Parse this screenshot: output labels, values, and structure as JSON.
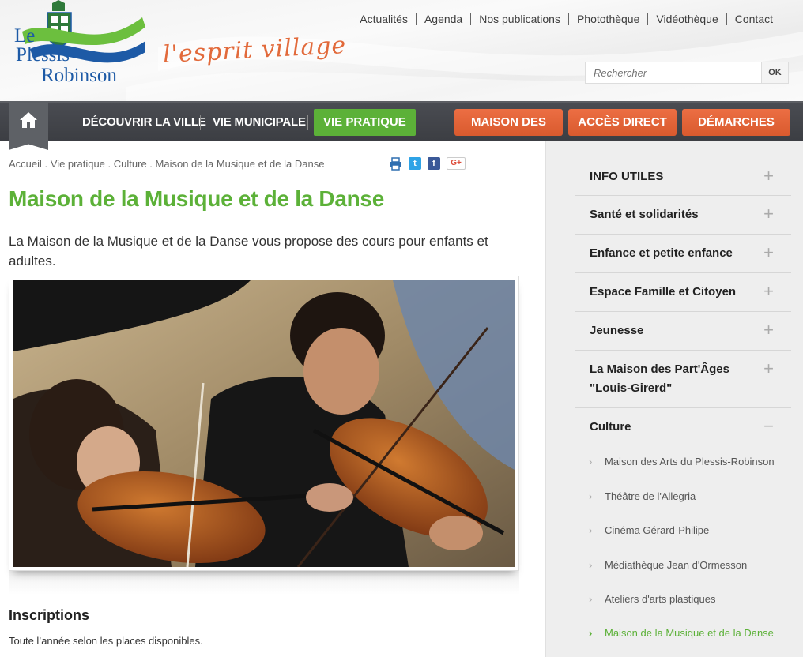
{
  "header": {
    "logo": {
      "line1": "Le",
      "line2": "Plessis",
      "line3": "Robinson"
    },
    "slogan": "l'esprit village",
    "top_links": [
      "Actualités",
      "Agenda",
      "Nos publications",
      "Photothèque",
      "Vidéothèque",
      "Contact"
    ],
    "search": {
      "placeholder": "Rechercher",
      "button": "OK"
    }
  },
  "mainnav": {
    "home_icon": "home-icon",
    "items": [
      "DÉCOUVRIR LA VILLE",
      "VIE MUNICIPALE"
    ],
    "active": "VIE PRATIQUE",
    "orange_buttons": [
      "MAISON DES ARTS",
      "ACCÈS DIRECT",
      "DÉMARCHES"
    ],
    "colors": {
      "green": "#5cb138",
      "orange": "#e2643a",
      "bar": "#404247"
    }
  },
  "breadcrumb": [
    "Accueil",
    "Vie pratique",
    "Culture",
    "Maison de la Musique et de la Danse"
  ],
  "share_icons": [
    "print-icon",
    "twitter-icon",
    "facebook-icon",
    "googleplus-icon"
  ],
  "share_labels": {
    "twitter": "t",
    "facebook": "f",
    "googleplus": "G+"
  },
  "page": {
    "title": "Maison de la Musique et de la Danse",
    "lead": "La Maison de la Musique et de la Danse vous propose des cours pour enfants et adultes.",
    "section_title": "Inscriptions",
    "section_text": "Toute l’année selon les places disponibles."
  },
  "sidebar": {
    "items": [
      {
        "label": "INFO UTILES",
        "toggle": "+"
      },
      {
        "label": "Santé et solidarités",
        "toggle": "+"
      },
      {
        "label": "Enfance et petite enfance",
        "toggle": "+"
      },
      {
        "label": "Espace Famille et Citoyen",
        "toggle": "+"
      },
      {
        "label": "Jeunesse",
        "toggle": "+"
      },
      {
        "label": "La Maison des Part'Âges \"Louis-Girerd\"",
        "toggle": "+"
      },
      {
        "label": "Culture",
        "toggle": "−"
      }
    ],
    "sub_items": [
      "Maison des Arts du Plessis-Robinson",
      "Théâtre de l'Allegria",
      "Cinéma Gérard-Philipe",
      "Médiathèque Jean d'Ormesson",
      "Ateliers d'arts plastiques",
      "Maison de la Musique et de la Danse"
    ]
  }
}
